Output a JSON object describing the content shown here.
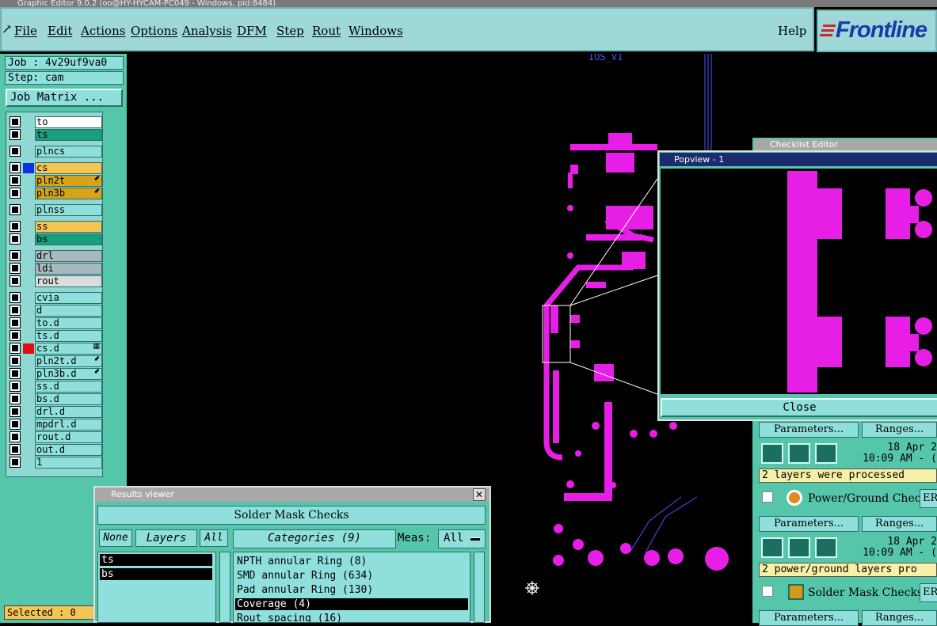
{
  "window_title": "Graphic Editor 9.0.2 (oo@HY-HYCAM-PC049 - Windows, pid:8484)",
  "menu": {
    "items": [
      "File",
      "Edit",
      "Actions",
      "Options",
      "Analysis",
      "DFM",
      "Step",
      "Rout",
      "Windows"
    ],
    "help": "Help"
  },
  "logo": {
    "text": "Frontline",
    "color": "#1a3aa8",
    "accent": "#d0262b"
  },
  "job": {
    "job_label": "Job : 4v29uf9va0",
    "step_label": "Step: cam",
    "matrix_button": "Job Matrix ..."
  },
  "layers": [
    {
      "name": "to",
      "color": "#ffffff",
      "swatch": "",
      "mark": ""
    },
    {
      "name": "ts",
      "color": "#1a9f7c",
      "swatch": "",
      "mark": ""
    },
    {
      "name": "plncs",
      "color": "#8fe0dc",
      "swatch": "",
      "mark": ""
    },
    {
      "name": "cs",
      "color": "#f5c553",
      "swatch": "#1030e0",
      "mark": ""
    },
    {
      "name": "pln2t",
      "color": "#d8a21a",
      "swatch": "",
      "mark": "⬋"
    },
    {
      "name": "pln3b",
      "color": "#d8a21a",
      "swatch": "",
      "mark": "⬋"
    },
    {
      "name": "plnss",
      "color": "#8fe0dc",
      "swatch": "",
      "mark": ""
    },
    {
      "name": "ss",
      "color": "#f5c553",
      "swatch": "",
      "mark": ""
    },
    {
      "name": "bs",
      "color": "#1a9f7c",
      "swatch": "",
      "mark": ""
    },
    {
      "name": "drl",
      "color": "#a8b8bc",
      "swatch": "",
      "mark": ""
    },
    {
      "name": "ldi",
      "color": "#a8b8bc",
      "swatch": "",
      "mark": ""
    },
    {
      "name": "rout",
      "color": "#dcdcdc",
      "swatch": "",
      "mark": ""
    },
    {
      "name": "cvia",
      "color": "#8fe0dc",
      "swatch": "",
      "mark": ""
    },
    {
      "name": "d",
      "color": "#8fe0dc",
      "swatch": "",
      "mark": ""
    },
    {
      "name": "to.d",
      "color": "#8fe0dc",
      "swatch": "",
      "mark": ""
    },
    {
      "name": "ts.d",
      "color": "#8fe0dc",
      "swatch": "",
      "mark": ""
    },
    {
      "name": "cs.d",
      "color": "#8fe0dc",
      "swatch": "#e01010",
      "mark": "▦"
    },
    {
      "name": "pln2t.d",
      "color": "#8fe0dc",
      "swatch": "",
      "mark": "⬋"
    },
    {
      "name": "pln3b.d",
      "color": "#8fe0dc",
      "swatch": "",
      "mark": "⬋"
    },
    {
      "name": "ss.d",
      "color": "#8fe0dc",
      "swatch": "",
      "mark": ""
    },
    {
      "name": "bs.d",
      "color": "#8fe0dc",
      "swatch": "",
      "mark": ""
    },
    {
      "name": "drl.d",
      "color": "#8fe0dc",
      "swatch": "",
      "mark": ""
    },
    {
      "name": "mpdrl.d",
      "color": "#8fe0dc",
      "swatch": "",
      "mark": ""
    },
    {
      "name": "rout.d",
      "color": "#8fe0dc",
      "swatch": "",
      "mark": ""
    },
    {
      "name": "out.d",
      "color": "#8fe0dc",
      "swatch": "",
      "mark": ""
    },
    {
      "name": "1",
      "color": "#8fe0dc",
      "swatch": "",
      "mark": ""
    }
  ],
  "status": {
    "selected": "Selected : 0"
  },
  "canvas": {
    "label": "IOS_V1",
    "trace_color": "#e61ee6"
  },
  "popview": {
    "title": "Popview - 1",
    "close": "Close"
  },
  "checklist": {
    "title": "Checklist Editor",
    "params_label": "Parameters...",
    "ranges_label": "Ranges...",
    "rows": [
      {
        "date": "18 Apr 2",
        "time": "10:09 AM - (",
        "status": "2 layers were processed"
      },
      {
        "date": "18 Apr 2",
        "time": "10:09 AM - (",
        "status": "2 power/ground layers pro"
      }
    ],
    "checks": [
      "Power/Ground Checks",
      "Solder Mask Checks"
    ],
    "er_label": "ER"
  },
  "results": {
    "title": "Results viewer",
    "header": "Solder Mask Checks",
    "none": "None",
    "layers": "Layers",
    "all": "All",
    "categories": "Categories (9)",
    "meas_label": "Meas:",
    "meas_value": "All",
    "layer_items": [
      "ts",
      "bs"
    ],
    "category_items": [
      "NPTH annular Ring (8)",
      "SMD annular Ring (634)",
      "Pad annular Ring (130)",
      "Coverage (4)",
      "Rout spacing (16)"
    ],
    "selected_category": 3
  }
}
